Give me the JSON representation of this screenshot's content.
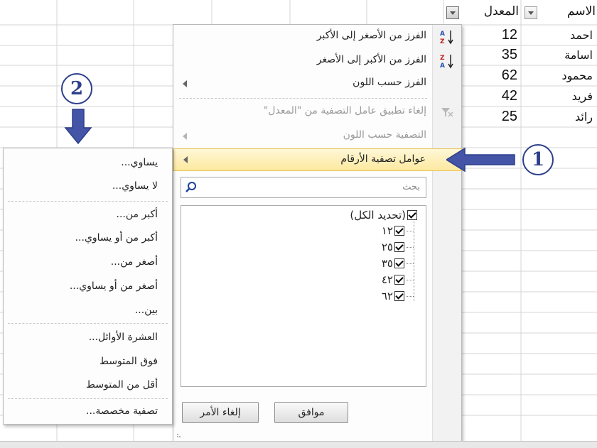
{
  "header": {
    "name_col": "الاسم",
    "avg_col": "المعدل"
  },
  "rows": [
    {
      "name": "احمد",
      "value": "12"
    },
    {
      "name": "اسامة",
      "value": "35"
    },
    {
      "name": "محمود",
      "value": "62"
    },
    {
      "name": "فريد",
      "value": "42"
    },
    {
      "name": "رائد",
      "value": "25"
    }
  ],
  "menu": {
    "sort_asc": "الفرز من الأصغر إلى الأكبر",
    "sort_desc": "الفرز من الأكبر إلى الأصغر",
    "sort_color": "الفرز حسب اللون",
    "clear_filter": "إلغاء تطبيق عامل التصفية من \"المعدل\"",
    "filter_color": "التصفية حسب اللون",
    "number_filters": "عوامل تصفية الأرقام",
    "search_placeholder": "بحث",
    "select_all": "(تحديد الكل)",
    "items": [
      "١٢",
      "٢٥",
      "٣٥",
      "٤٢",
      "٦٢"
    ],
    "ok": "موافق",
    "cancel": "إلغاء الأمر"
  },
  "submenu": {
    "equals": "يساوي...",
    "not_equals": "لا يساوي...",
    "greater": "أكبر من...",
    "greater_eq": "أكبر من أو يساوي...",
    "less": "أصغر من...",
    "less_eq": "أصغر من أو يساوي...",
    "between": "بين...",
    "top10": "العشرة الأوائل...",
    "above_avg": "فوق المتوسط",
    "below_avg": "أقل من المتوسط",
    "custom": "تصفية مخصصة..."
  },
  "callouts": {
    "one": "1",
    "two": "2"
  },
  "colors": {
    "callout": "#2d3f8a",
    "arrow": "#4455a8",
    "highlight": "#fde99f"
  }
}
